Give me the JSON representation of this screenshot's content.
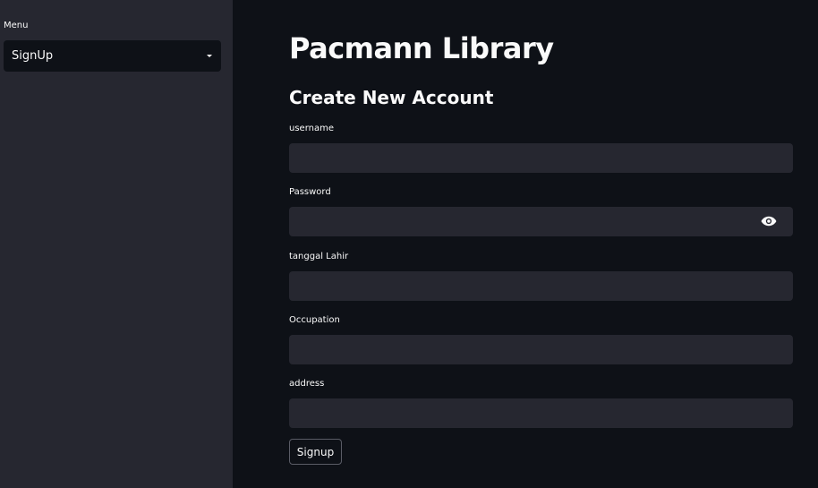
{
  "sidebar": {
    "menu_label": "Menu",
    "menu_select": {
      "selected": "SignUp"
    }
  },
  "main": {
    "title": "Pacmann Library",
    "subtitle": "Create New Account",
    "fields": {
      "username": {
        "label": "username",
        "value": ""
      },
      "password": {
        "label": "Password",
        "value": ""
      },
      "birthdate": {
        "label": "tanggal Lahir",
        "value": ""
      },
      "occupation": {
        "label": "Occupation",
        "value": ""
      },
      "address": {
        "label": "address",
        "value": ""
      }
    },
    "submit_label": "Signup"
  },
  "icons": {
    "dropdown": "chevron-down-icon",
    "password_toggle": "eye-icon"
  },
  "colors": {
    "background": "#0e1117",
    "sidebar": "#262730",
    "input": "#262730",
    "text": "#fafafa"
  }
}
